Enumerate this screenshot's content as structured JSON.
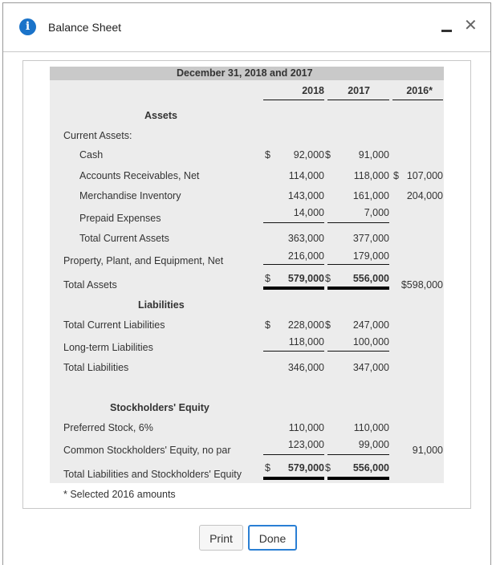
{
  "dialog": {
    "title": "Balance Sheet",
    "icon": "info-icon",
    "accent": "#1a73c9"
  },
  "sheet": {
    "heading": "December 31, 2018 and 2017",
    "columns": [
      "2018",
      "2017",
      "2016*"
    ],
    "assets_header": "Assets",
    "current_assets_label": "Current Assets:",
    "rows": {
      "cash": {
        "label": "Cash",
        "c2018": "92,000",
        "c2017": "91,000",
        "c2016": ""
      },
      "ar": {
        "label": "Accounts Receivables, Net",
        "c2018": "114,000",
        "c2017": "118,000",
        "c2016": "107,000"
      },
      "inv": {
        "label": "Merchandise Inventory",
        "c2018": "143,000",
        "c2017": "161,000",
        "c2016": "204,000"
      },
      "prepaid": {
        "label": "Prepaid Expenses",
        "c2018": "14,000",
        "c2017": "7,000"
      },
      "tca": {
        "label": "Total Current Assets",
        "c2018": "363,000",
        "c2017": "377,000"
      },
      "ppe": {
        "label": "Property, Plant, and Equipment, Net",
        "c2018": "216,000",
        "c2017": "179,000"
      },
      "ta": {
        "label": "Total Assets",
        "c2018": "579,000",
        "c2017": "556,000",
        "c2016": "$598,000"
      },
      "tcl": {
        "label": "Total Current Liabilities",
        "c2018": "228,000",
        "c2017": "247,000"
      },
      "ltl": {
        "label": "Long-term Liabilities",
        "c2018": "118,000",
        "c2017": "100,000"
      },
      "tl": {
        "label": "Total Liabilities",
        "c2018": "346,000",
        "c2017": "347,000"
      },
      "pref": {
        "label": "Preferred Stock, 6%",
        "c2018": "110,000",
        "c2017": "110,000"
      },
      "common": {
        "label": "Common Stockholders' Equity, no par",
        "c2018": "123,000",
        "c2017": "99,000",
        "c2016": "91,000"
      },
      "tlse": {
        "label": "Total Liabilities and Stockholders' Equity",
        "c2018": "579,000",
        "c2017": "556,000"
      }
    },
    "liabilities_header": "Liabilities",
    "equity_header": "Stockholders' Equity",
    "dollar": "$",
    "footnote": "* Selected 2016 amounts"
  },
  "buttons": {
    "print": "Print",
    "done": "Done"
  }
}
